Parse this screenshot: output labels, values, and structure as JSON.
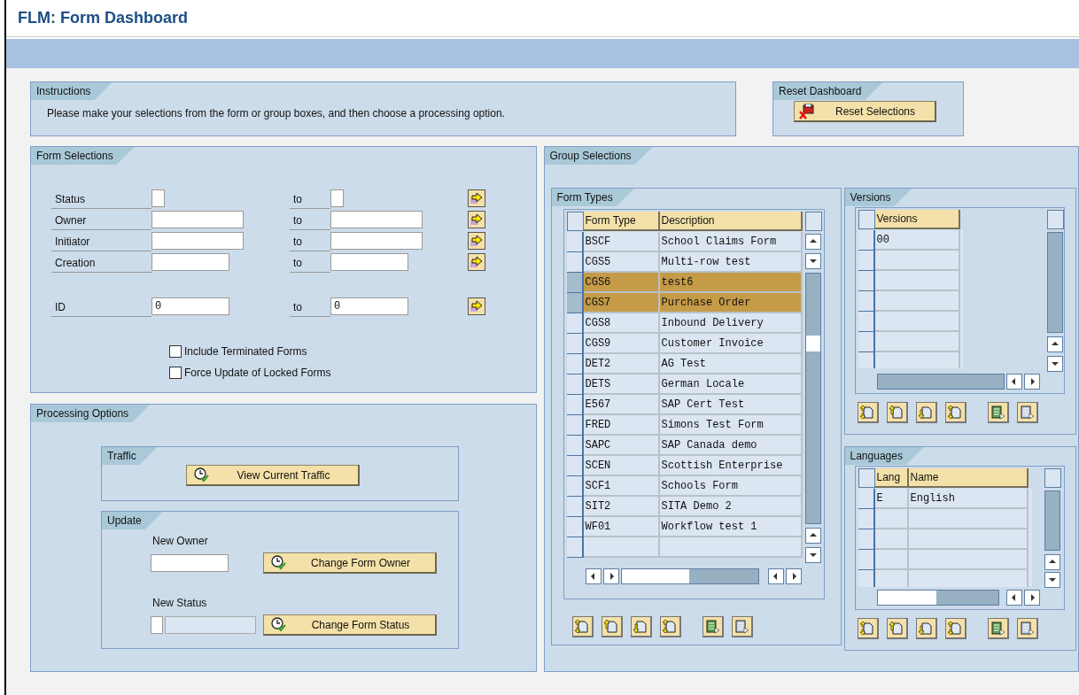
{
  "title": "FLM: Form Dashboard",
  "instructions": {
    "title": "Instructions",
    "text": "Please make your selections from the form or group boxes, and then choose a processing option."
  },
  "reset": {
    "title": "Reset Dashboard",
    "button": "Reset Selections"
  },
  "form_selections": {
    "title": "Form Selections",
    "rows": [
      {
        "label": "Status",
        "to_label": "to"
      },
      {
        "label": "Owner",
        "to_label": "to"
      },
      {
        "label": "Initiator",
        "to_label": "to"
      },
      {
        "label": "Creation",
        "to_label": "to"
      },
      {
        "label": "ID",
        "from_value": "0",
        "to_label": "to",
        "to_value": "0"
      }
    ],
    "checkboxes": [
      {
        "label": "Include Terminated Forms",
        "checked": false
      },
      {
        "label": "Force Update of Locked Forms",
        "checked": false
      }
    ]
  },
  "processing": {
    "title": "Processing Options",
    "traffic": {
      "title": "Traffic",
      "button": "View Current Traffic"
    },
    "update": {
      "title": "Update",
      "owner_label": "New Owner",
      "owner_button": "Change Form Owner",
      "status_label": "New Status",
      "status_button": "Change Form Status"
    }
  },
  "group_selections": {
    "title": "Group Selections",
    "form_types": {
      "title": "Form Types",
      "columns": [
        "Form Type",
        "Description"
      ],
      "rows": [
        {
          "cells": [
            "BSCF",
            "School Claims Form"
          ],
          "selected": false
        },
        {
          "cells": [
            "CGS5",
            "Multi-row test"
          ],
          "selected": false
        },
        {
          "cells": [
            "CGS6",
            "test6"
          ],
          "selected": true
        },
        {
          "cells": [
            "CGS7",
            "Purchase Order"
          ],
          "selected": true
        },
        {
          "cells": [
            "CGS8",
            "Inbound Delivery"
          ],
          "selected": false
        },
        {
          "cells": [
            "CGS9",
            "Customer Invoice"
          ],
          "selected": false
        },
        {
          "cells": [
            "DET2",
            "AG Test"
          ],
          "selected": false
        },
        {
          "cells": [
            "DETS",
            "German Locale"
          ],
          "selected": false
        },
        {
          "cells": [
            "E567",
            "SAP Cert Test"
          ],
          "selected": false
        },
        {
          "cells": [
            "FRED",
            "Simons Test Form"
          ],
          "selected": false
        },
        {
          "cells": [
            "SAPC",
            "SAP Canada demo"
          ],
          "selected": false
        },
        {
          "cells": [
            "SCEN",
            "Scottish Enterprise"
          ],
          "selected": false
        },
        {
          "cells": [
            "SCF1",
            "Schools Form"
          ],
          "selected": false
        },
        {
          "cells": [
            "SIT2",
            "SITA Demo 2"
          ],
          "selected": false
        },
        {
          "cells": [
            "WF01",
            "Workflow test 1"
          ],
          "selected": false
        }
      ]
    },
    "versions": {
      "title": "Versions",
      "columns": [
        "Versions"
      ],
      "rows": [
        {
          "cells": [
            "00"
          ],
          "selected": false
        }
      ]
    },
    "languages": {
      "title": "Languages",
      "columns": [
        "Lang",
        "Name"
      ],
      "rows": [
        {
          "cells": [
            "E",
            "English"
          ],
          "selected": false
        }
      ]
    }
  }
}
